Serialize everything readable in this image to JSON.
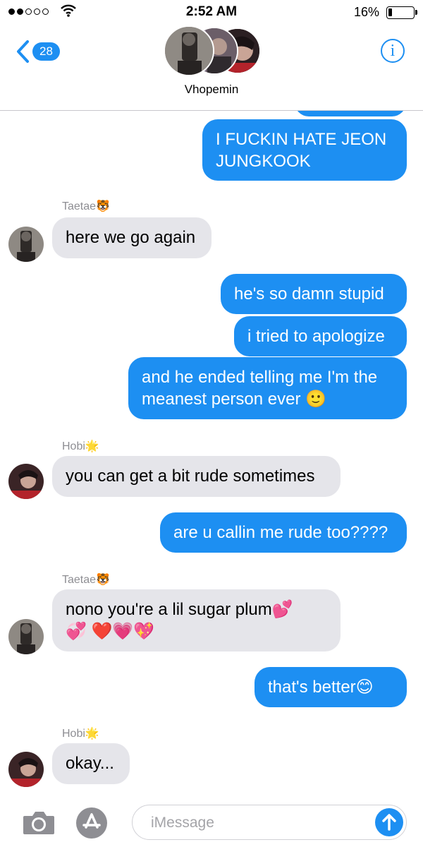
{
  "status": {
    "time": "2:52 AM",
    "battery": "16%"
  },
  "header": {
    "back_count": "28",
    "group_name": "Vhopemin"
  },
  "messages": {
    "m1": "I FUCKIN HATE JEON JUNGKOOK",
    "s1": "Taetae🐯",
    "m2": "here we go again",
    "m3": "he's so damn stupid",
    "m4": "i tried to apologize",
    "m5": "and he ended telling me I'm the meanest person ever 🙂",
    "s2": "Hobi🌟",
    "m6": "you can get a bit rude sometimes",
    "m7": "are u callin me rude too????",
    "s3": "Taetae🐯",
    "m8": "nono you're a lil sugar plum💕💞 ❤️💗💖",
    "m9": "that's better😊",
    "s4": "Hobi🌟",
    "m10": "okay..."
  },
  "composer": {
    "placeholder": "iMessage"
  },
  "colors": {
    "accent": "#1d8ff2",
    "incoming": "#e5e5ea"
  }
}
